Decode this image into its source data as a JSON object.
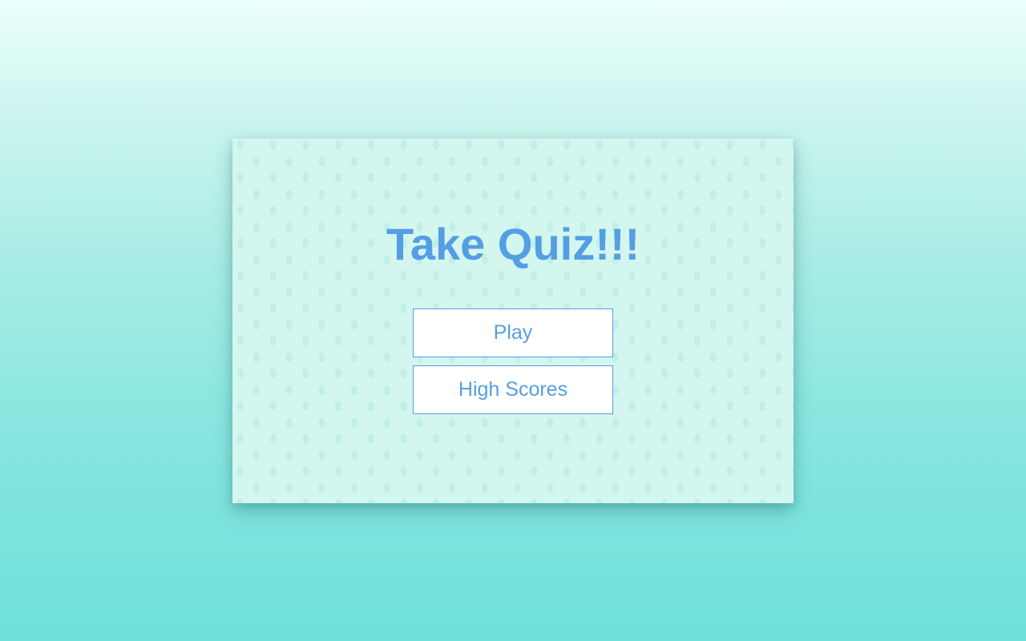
{
  "quiz_menu": {
    "title": "Take Quiz!!!",
    "play_label": "Play",
    "high_scores_label": "High Scores"
  },
  "colors": {
    "accent": "#559ee3",
    "card_background": "#d3f6ef",
    "button_background": "#ffffff",
    "page_gradient_top": "#ebfffb",
    "page_gradient_bottom": "#6de1da"
  },
  "icons": {
    "background_pattern": "water-drop-pattern"
  }
}
